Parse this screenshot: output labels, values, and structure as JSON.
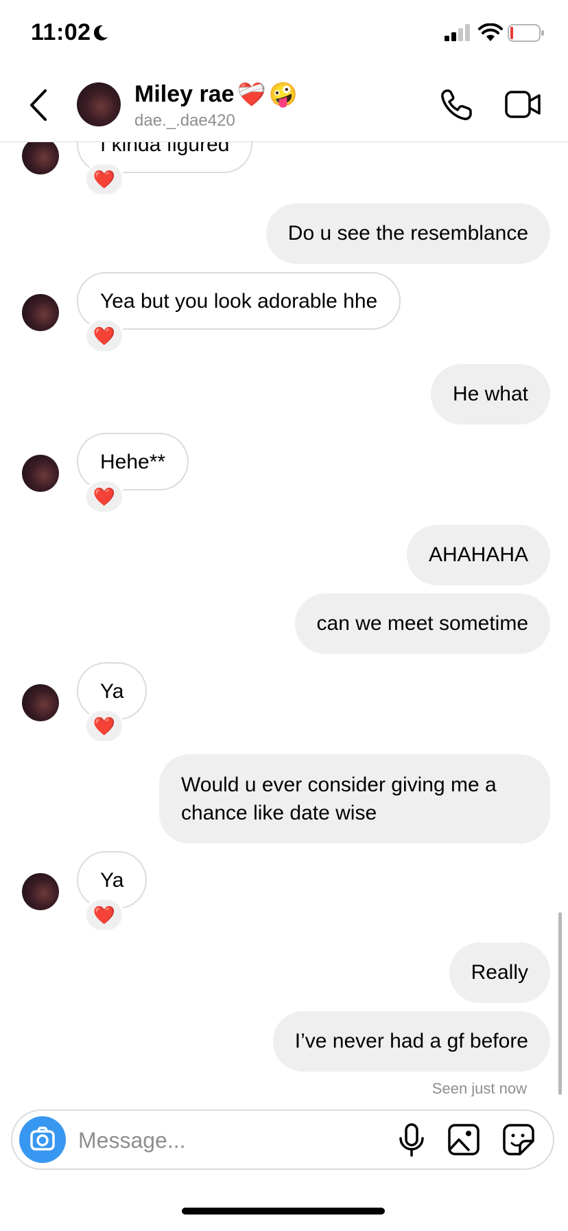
{
  "status_bar": {
    "time": "11:02"
  },
  "header": {
    "name": "Miley rae",
    "name_emojis": [
      "❤️‍🩹",
      "🤪"
    ],
    "username": "dae._.dae420"
  },
  "messages": [
    {
      "side": "in",
      "text": "I kinda figured",
      "reaction": "❤️"
    },
    {
      "side": "out",
      "text": "Do u see the resemblance"
    },
    {
      "side": "in",
      "text": "Yea but you look adorable hhe",
      "reaction": "❤️"
    },
    {
      "side": "out",
      "text": "He what"
    },
    {
      "side": "in",
      "text": "Hehe**",
      "reaction": "❤️"
    },
    {
      "side": "out",
      "text": "AHAHAHA"
    },
    {
      "side": "out",
      "text": "can we meet sometime"
    },
    {
      "side": "in",
      "text": "Ya",
      "reaction": "❤️"
    },
    {
      "side": "out",
      "text": "Would u ever consider giving me a chance like date wise"
    },
    {
      "side": "in",
      "text": "Ya",
      "reaction": "❤️"
    },
    {
      "side": "out",
      "text": "Really"
    },
    {
      "side": "out",
      "text": "I’ve never had a gf before"
    }
  ],
  "seen_label": "Seen just now",
  "composer": {
    "placeholder": "Message..."
  },
  "colors": {
    "accent": "#3897f0",
    "outgoing_bubble": "#efefef",
    "reaction": "#e0245e"
  }
}
